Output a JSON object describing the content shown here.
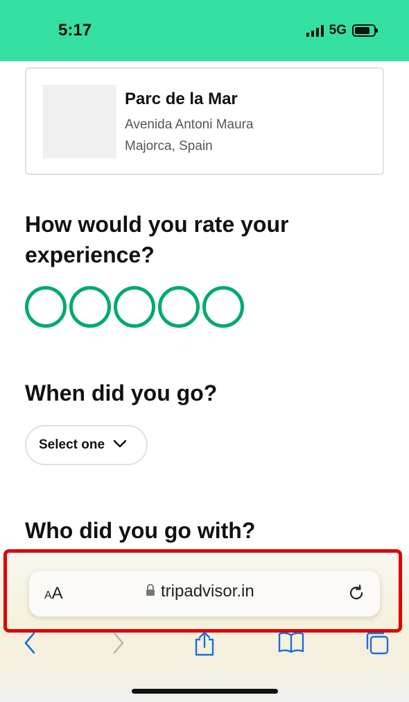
{
  "status_bar": {
    "time": "5:17",
    "network": "5G",
    "battery_level": 0.8,
    "color": "#34e0a1"
  },
  "place": {
    "name": "Parc de la Mar",
    "address_line1": "Avenida Antoni Maura",
    "address_line2": "Majorca, Spain"
  },
  "rating_question": "How would you rate your experience?",
  "rating": {
    "max": 5,
    "selected": 0,
    "color": "#00aa6c"
  },
  "when_question": "When did you go?",
  "when_select": {
    "value": "Select one"
  },
  "who_question": "Who did you go with?",
  "browser": {
    "aa_label_small": "A",
    "aa_label_large": "A",
    "url": "tripadvisor.in",
    "icons": [
      "back-icon",
      "forward-icon",
      "share-icon",
      "bookmarks-icon",
      "tabs-icon"
    ]
  }
}
